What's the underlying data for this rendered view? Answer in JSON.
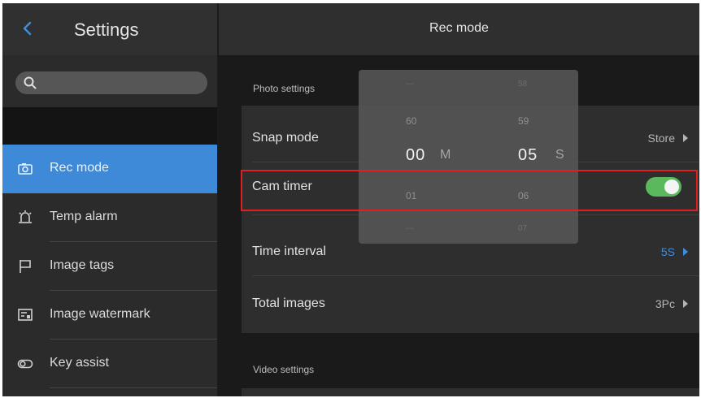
{
  "sidebar": {
    "title": "Settings",
    "search": {
      "placeholder": "",
      "value": ""
    },
    "items": [
      {
        "label": "Rec mode",
        "icon": "camera-icon",
        "active": true
      },
      {
        "label": "Temp alarm",
        "icon": "alarm-icon",
        "active": false
      },
      {
        "label": "Image tags",
        "icon": "flag-icon",
        "active": false
      },
      {
        "label": "Image watermark",
        "icon": "watermark-icon",
        "active": false
      },
      {
        "label": "Key assist",
        "icon": "toggle-link-icon",
        "active": false
      }
    ]
  },
  "main": {
    "title": "Rec mode",
    "photo_section_label": "Photo settings",
    "video_section_label": "Video settings",
    "rows": {
      "snap_mode": {
        "label": "Snap mode",
        "value": "Store"
      },
      "cam_timer": {
        "label": "Cam timer",
        "enabled": true
      },
      "time_interval": {
        "label": "Time interval",
        "value": "5S"
      },
      "total_images": {
        "label": "Total images",
        "value": "3Pc"
      }
    }
  },
  "picker": {
    "minutes": {
      "above2": "---",
      "above1": "60",
      "selected": "00",
      "below1": "01",
      "below2": "---",
      "unit": "M"
    },
    "seconds": {
      "above2": "58",
      "above1": "59",
      "selected": "05",
      "below1": "06",
      "below2": "07",
      "unit": "S"
    }
  },
  "colors": {
    "accent": "#3f8ad8",
    "toggle_on": "#5cb85c",
    "highlight": "#e02020"
  }
}
